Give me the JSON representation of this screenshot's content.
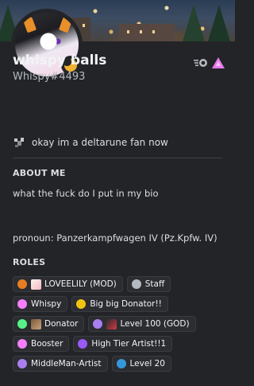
{
  "user": {
    "display_name": "whispy balls",
    "tag": "Whispy#4493",
    "custom_status": "okay im a deltarune fan now",
    "status_color": "#f0b232"
  },
  "badges": [
    {
      "icon": "nitro-badge-icon"
    },
    {
      "icon": "triangle-badge-icon"
    }
  ],
  "about": {
    "title": "ABOUT ME",
    "line1": "what the fuck do I put in my bio",
    "line2": "pronoun: Panzerkampfwagen IV (Pz.Kpfw. IV)"
  },
  "roles_section": {
    "title": "ROLES",
    "roles": [
      {
        "name": "LOVEELILY (MOD)",
        "color": "#e67e22",
        "icon": "avatar-image-icon"
      },
      {
        "name": "Staff",
        "color": "#b5bac1"
      },
      {
        "name": "Whispy",
        "color": "#f47fff"
      },
      {
        "name": "Big big Donator!!",
        "color": "#f1c40f"
      },
      {
        "name": "Donator",
        "color": "#57f287",
        "icon": "image-icon"
      },
      {
        "name": "Level 100 (GOD)",
        "color": "#a97ff0",
        "icon": "image-icon"
      },
      {
        "name": "Booster",
        "color": "#f47fff"
      },
      {
        "name": "High Tier Artist!!1",
        "color": "#9b59f6"
      },
      {
        "name": "MiddleMan-Artist",
        "color": "#a97ff0"
      },
      {
        "name": "Level 20",
        "color": "#3498db"
      }
    ]
  }
}
